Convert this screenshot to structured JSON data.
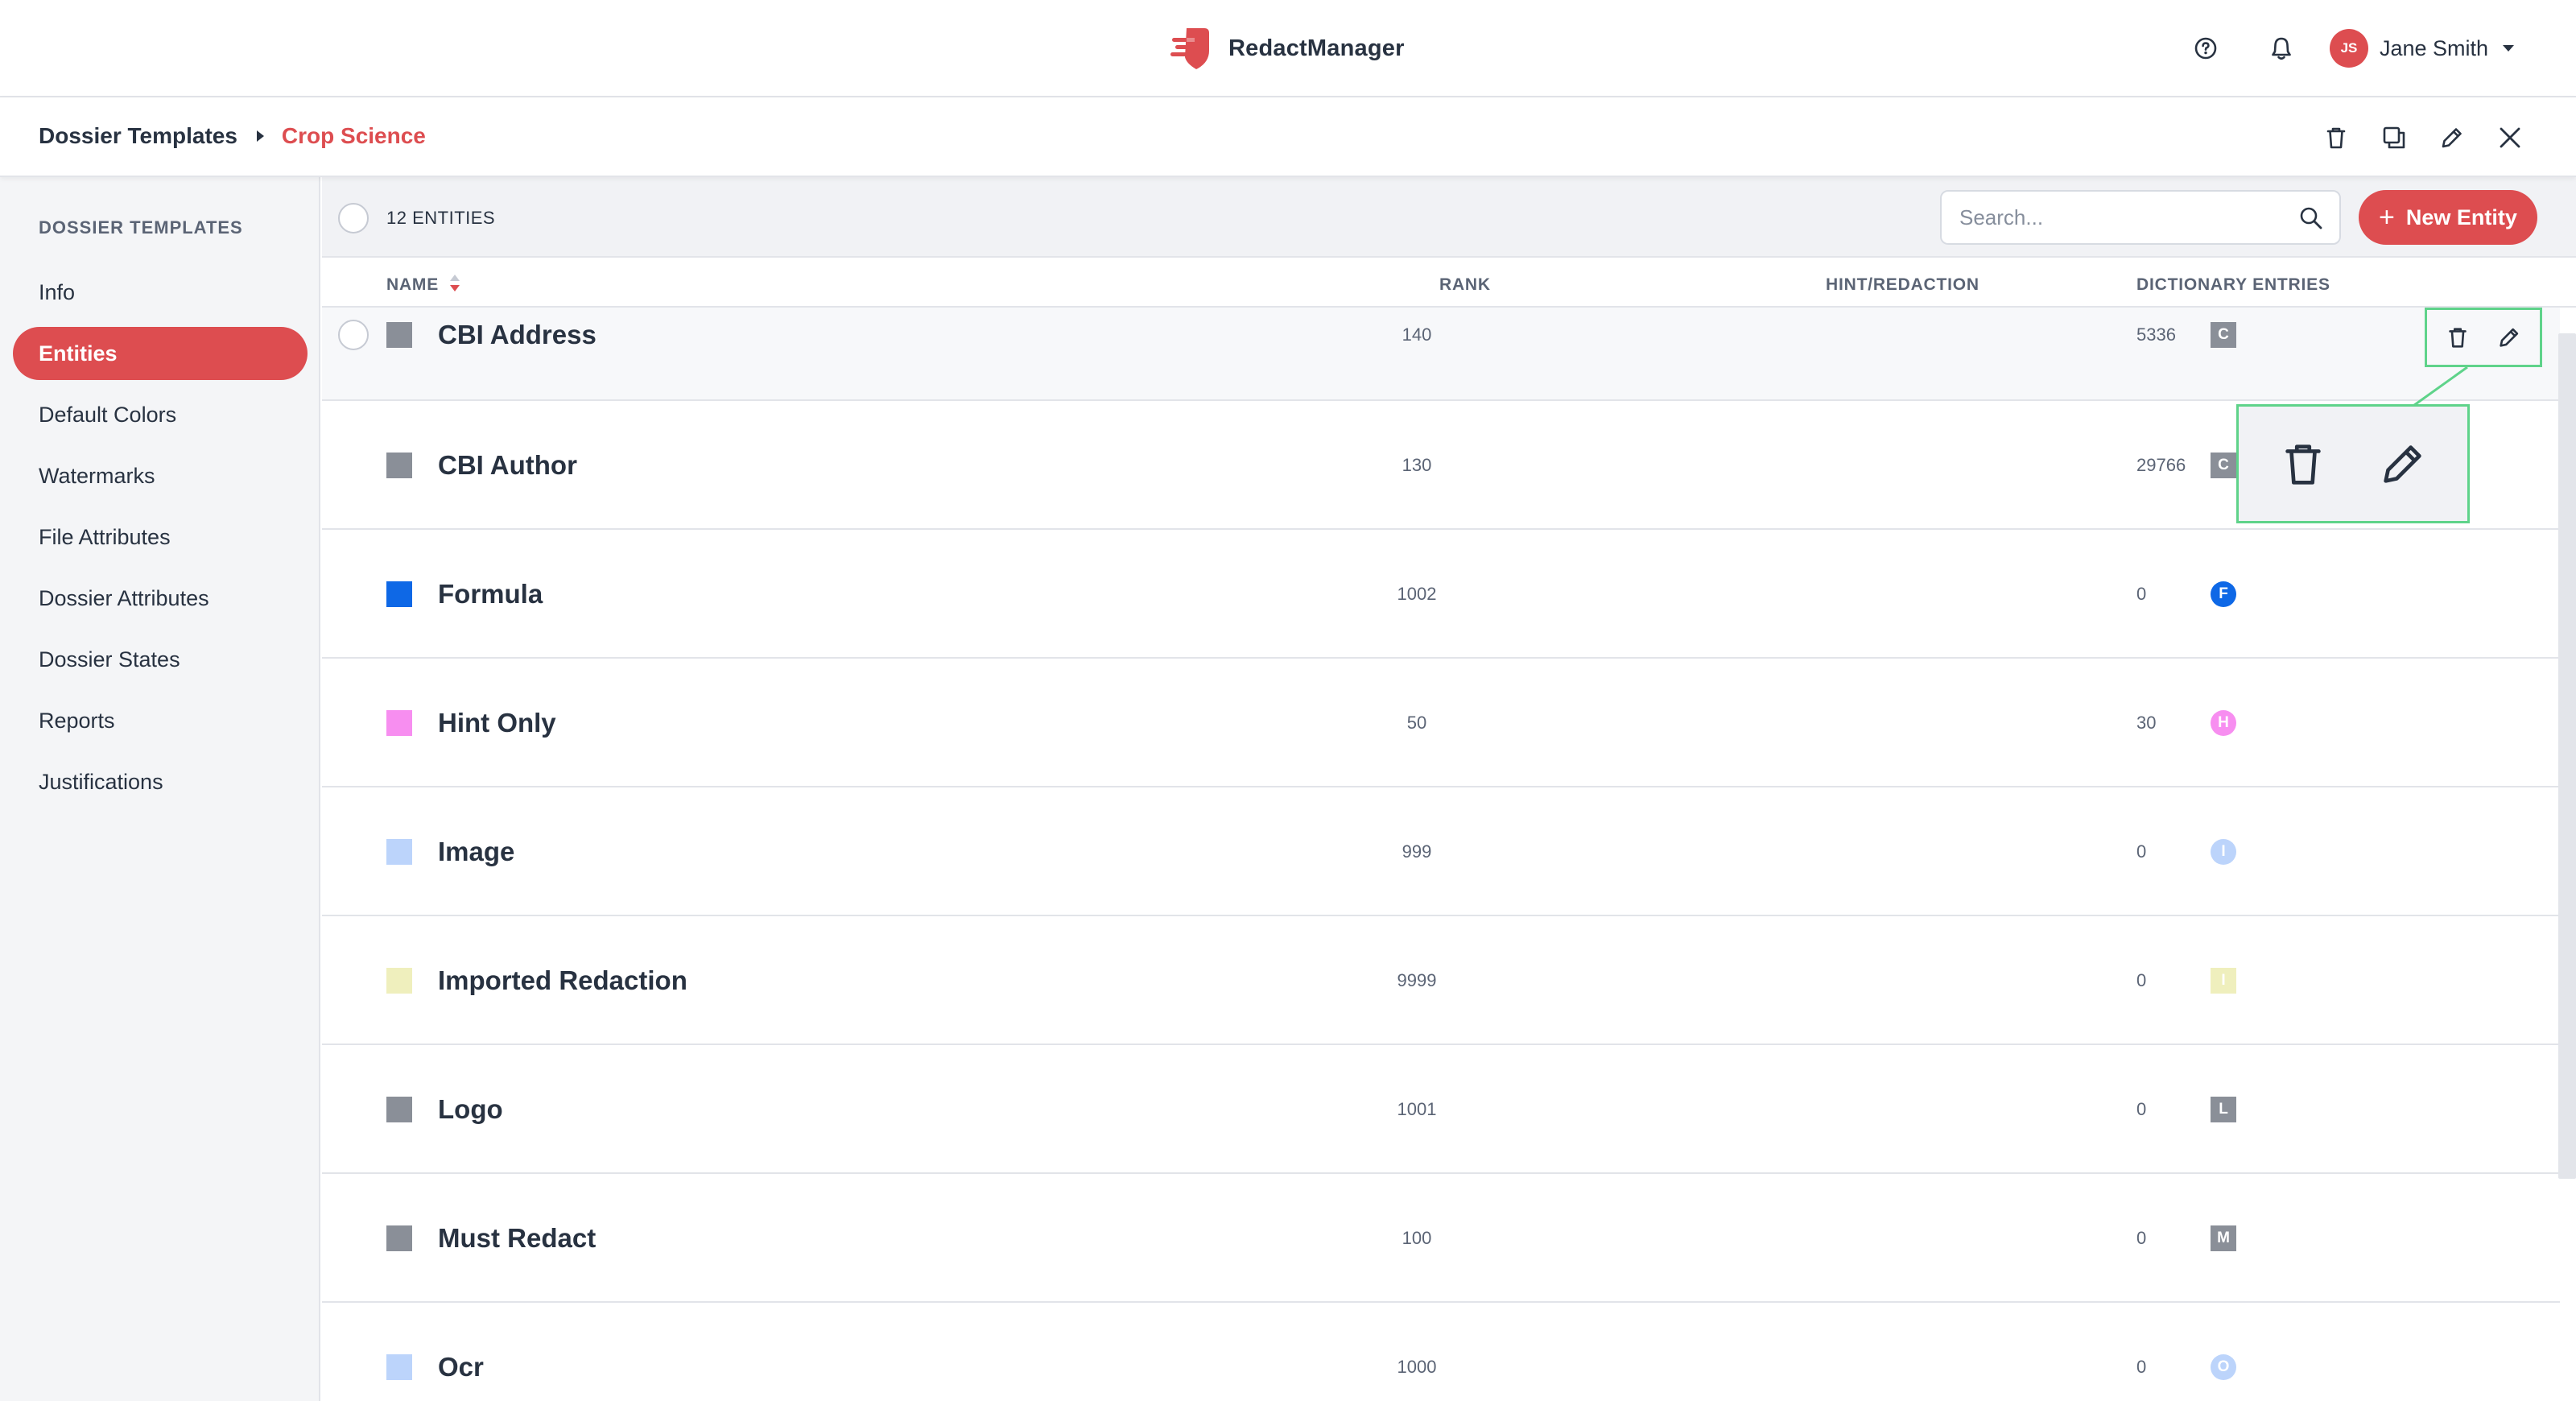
{
  "app": {
    "name": "RedactManager",
    "brand_color": "#dd4d50"
  },
  "header": {
    "help_icon": "help-circle-icon",
    "notifications_icon": "bell-icon",
    "user": {
      "initials": "JS",
      "name": "Jane Smith"
    }
  },
  "breadcrumb": {
    "root": "Dossier Templates",
    "current": "Crop Science",
    "actions": [
      "trash-icon",
      "copy-icon",
      "pencil-icon",
      "close-icon"
    ]
  },
  "sidebar": {
    "heading": "DOSSIER TEMPLATES",
    "items": [
      {
        "label": "Info",
        "active": false
      },
      {
        "label": "Entities",
        "active": true
      },
      {
        "label": "Default Colors",
        "active": false
      },
      {
        "label": "Watermarks",
        "active": false
      },
      {
        "label": "File Attributes",
        "active": false
      },
      {
        "label": "Dossier Attributes",
        "active": false
      },
      {
        "label": "Dossier States",
        "active": false
      },
      {
        "label": "Reports",
        "active": false
      },
      {
        "label": "Justifications",
        "active": false
      }
    ]
  },
  "toolbar": {
    "count_label": "12 ENTITIES",
    "search_placeholder": "Search...",
    "search_value": "",
    "new_button_label": "New Entity",
    "new_button_plus": "+"
  },
  "table": {
    "columns": {
      "name": "NAME",
      "rank": "RANK",
      "hint": "HINT/REDACTION",
      "entries": "DICTIONARY ENTRIES"
    },
    "sort": {
      "column": "name",
      "direction": "ascending"
    },
    "rows": [
      {
        "name": "CBI Address",
        "rank": "140",
        "badge": "C",
        "badge_shape": "square",
        "color": "#8a8f98",
        "badge_color": "#8a8f98",
        "entries": "5336"
      },
      {
        "name": "CBI Author",
        "rank": "130",
        "badge": "C",
        "badge_shape": "square",
        "color": "#8a8f98",
        "badge_color": "#8a8f98",
        "entries": "29766"
      },
      {
        "name": "Formula",
        "rank": "1002",
        "badge": "F",
        "badge_shape": "round",
        "color": "#0e68e6",
        "badge_color": "#0e68e6",
        "entries": "0"
      },
      {
        "name": "Hint Only",
        "rank": "50",
        "badge": "H",
        "badge_shape": "round",
        "color": "#f78ef0",
        "badge_color": "#f78ef0",
        "entries": "30"
      },
      {
        "name": "Image",
        "rank": "999",
        "badge": "I",
        "badge_shape": "round",
        "color": "#bcd4fb",
        "badge_color": "#bcd4fb",
        "entries": "0"
      },
      {
        "name": "Imported Redaction",
        "rank": "9999",
        "badge": "I",
        "badge_shape": "square",
        "color": "#efefbd",
        "badge_color": "#efefbd",
        "entries": "0"
      },
      {
        "name": "Logo",
        "rank": "1001",
        "badge": "L",
        "badge_shape": "square",
        "color": "#8a8f98",
        "badge_color": "#8a8f98",
        "entries": "0"
      },
      {
        "name": "Must Redact",
        "rank": "100",
        "badge": "M",
        "badge_shape": "square",
        "color": "#8a8f98",
        "badge_color": "#8a8f98",
        "entries": "0"
      },
      {
        "name": "Ocr",
        "rank": "1000",
        "badge": "O",
        "badge_shape": "round",
        "color": "#bcd4fb",
        "badge_color": "#bcd4fb",
        "entries": "0"
      }
    ],
    "row_actions": [
      "trash-icon",
      "pencil-icon"
    ],
    "highlight_color": "#5fd38a"
  }
}
